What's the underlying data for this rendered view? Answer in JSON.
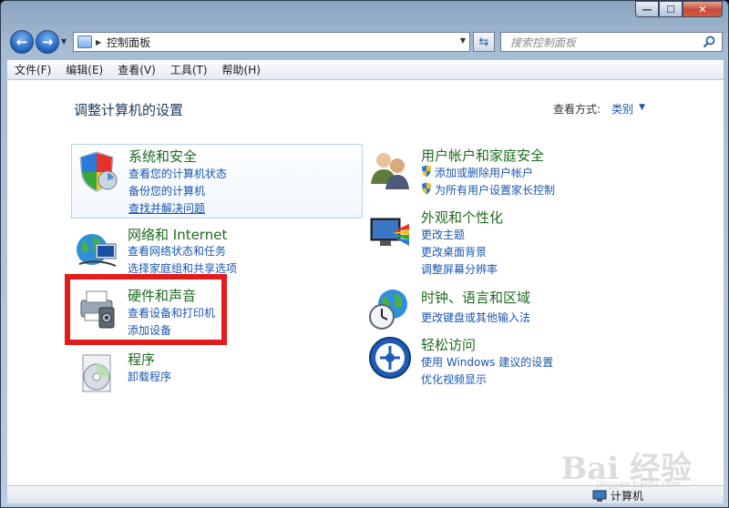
{
  "window": {
    "caption": {
      "minimize": "—",
      "maximize": "☐",
      "close": "✕"
    }
  },
  "nav": {
    "back_glyph": "←",
    "forward_glyph": "→",
    "history_glyph": "▼",
    "address_sep": "▶",
    "address": "控制面板",
    "address_dropdown": "▼",
    "refresh_glyph": "⇆",
    "search_placeholder": "搜索控制面板"
  },
  "menubar": [
    "文件(F)",
    "编辑(E)",
    "查看(V)",
    "工具(T)",
    "帮助(H)"
  ],
  "page": {
    "title": "调整计算机的设置",
    "view_by_label": "查看方式:",
    "view_by_value": "类别",
    "view_by_caret": "▼"
  },
  "categories": {
    "system": {
      "title": "系统和安全",
      "icon": "shield-icon",
      "links": [
        "查看您的计算机状态",
        "备份您的计算机",
        "查找并解决问题"
      ]
    },
    "network": {
      "title": "网络和 Internet",
      "icon": "globe-network-icon",
      "links": [
        "查看网络状态和任务",
        "选择家庭组和共享选项"
      ]
    },
    "hardware": {
      "title": "硬件和声音",
      "icon": "printer-icon",
      "links": [
        "查看设备和打印机",
        "添加设备"
      ]
    },
    "programs": {
      "title": "程序",
      "icon": "programs-disc-icon",
      "links": [
        "卸载程序"
      ]
    },
    "users": {
      "title": "用户帐户和家庭安全",
      "icon": "users-icon",
      "links": [
        "添加或删除用户帐户",
        "为所有用户设置家长控制"
      ]
    },
    "appearance": {
      "title": "外观和个性化",
      "icon": "monitor-palette-icon",
      "links": [
        "更改主题",
        "更改桌面背景",
        "调整屏幕分辨率"
      ]
    },
    "clock": {
      "title": "时钟、语言和区域",
      "icon": "clock-globe-icon",
      "links": [
        "更改键盘或其他输入法"
      ]
    },
    "ease": {
      "title": "轻松访问",
      "icon": "ease-of-access-icon",
      "links": [
        "使用 Windows 建议的设置",
        "优化视频显示"
      ]
    }
  },
  "status": {
    "computer": "计算机"
  },
  "watermark": {
    "main": "Bai 经验",
    "sub": "jingyan.baidu.com"
  },
  "colors": {
    "accent_red": "#e51b1b",
    "link": "#1a56b0",
    "category_title": "#1e6b1e"
  }
}
